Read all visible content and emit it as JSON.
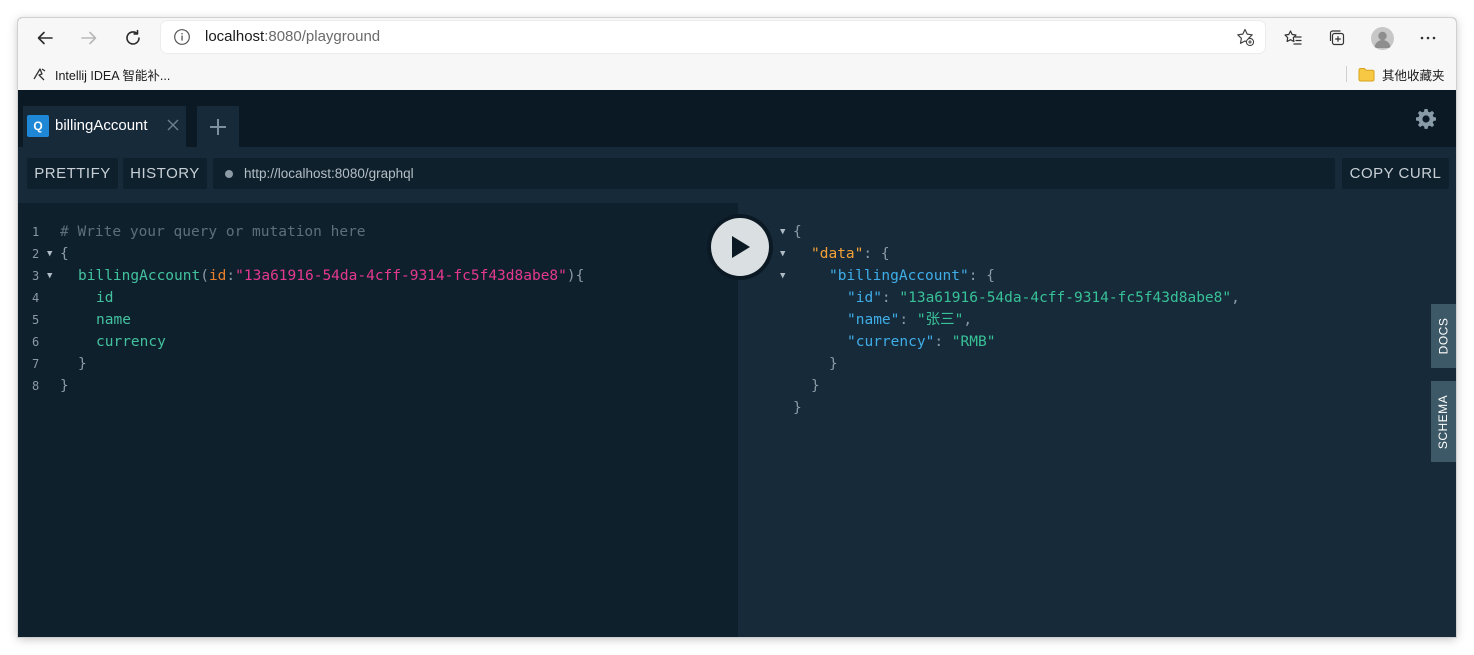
{
  "browser": {
    "url_host": "localhost",
    "url_rest": ":8080/playground",
    "bookmarks": [
      {
        "label": "Intellij IDEA 智能补..."
      }
    ],
    "other_bookmarks": "其他收藏夹"
  },
  "tabs": [
    {
      "badge": "Q",
      "title": "billingAccount"
    }
  ],
  "toolbar": {
    "prettify": "PRETTIFY",
    "history": "HISTORY",
    "endpoint": "http://localhost:8080/graphql",
    "copy_curl": "COPY CURL"
  },
  "query": {
    "line_numbers": [
      "1",
      "2",
      "3",
      "4",
      "5",
      "6",
      "7",
      "8"
    ],
    "comment": "# Write your query or mutation here",
    "open_brace": "{",
    "field": "billingAccount",
    "arg_open": "(",
    "arg_name": "id",
    "arg_colon": ":",
    "arg_value": "\"13a61916-54da-4cff-9314-fc5f43d8abe8\"",
    "arg_close": "){",
    "subfields": [
      "id",
      "name",
      "currency"
    ],
    "inner_close": "}",
    "outer_close": "}"
  },
  "result": {
    "open": "{",
    "data_key": "\"data\"",
    "billing_key": "\"billingAccount\"",
    "lines": [
      {
        "key": "\"id\"",
        "value": "\"13a61916-54da-4cff-9314-fc5f43d8abe8\"",
        "sep": ","
      },
      {
        "key": "\"name\"",
        "value": "\"张三\"",
        "sep": ","
      },
      {
        "key": "\"currency\"",
        "value": "\"RMB\"",
        "sep": ""
      }
    ],
    "colon": ": ",
    "open_brace": "{",
    "close": "}"
  },
  "sidebar": {
    "docs": "DOCS",
    "schema": "SCHEMA"
  },
  "colors": {
    "editor_bg": "#0f202d",
    "result_bg": "#172a3a",
    "tabbar_bg": "#0b1924",
    "badge": "#1f88d6",
    "field": "#43c29f",
    "argument": "#e87d2b",
    "string": "#e5388f",
    "result_key": "#3faee8",
    "result_string": "#38c197"
  },
  "icons": [
    "back-arrow-icon",
    "forward-arrow-icon",
    "reload-icon",
    "info-icon",
    "add-favorite-icon",
    "favorites-icon",
    "collections-icon",
    "profile-icon",
    "more-icon",
    "intellij-icon",
    "folder-icon",
    "close-icon",
    "plus-icon",
    "gear-icon",
    "play-icon"
  ]
}
